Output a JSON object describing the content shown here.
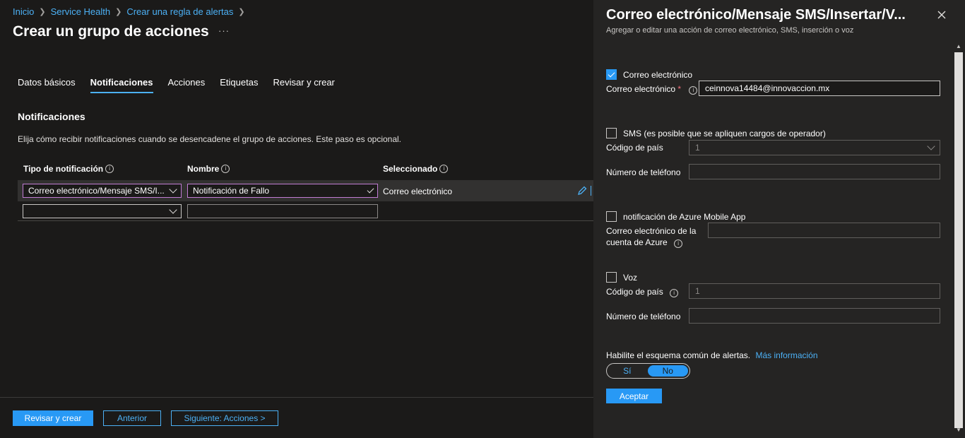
{
  "breadcrumb": [
    "Inicio",
    "Service Health",
    "Crear una regla de alertas"
  ],
  "page_title": "Crear un grupo de acciones",
  "more_label": "···",
  "tabs": [
    {
      "label": "Datos básicos"
    },
    {
      "label": "Notificaciones"
    },
    {
      "label": "Acciones"
    },
    {
      "label": "Etiquetas"
    },
    {
      "label": "Revisar y crear"
    }
  ],
  "section": {
    "title": "Notificaciones",
    "description": "Elija cómo recibir notificaciones cuando se desencadene el grupo de acciones. Este paso es opcional."
  },
  "table": {
    "headers": [
      "Tipo de notificación",
      "Nombre",
      "Seleccionado"
    ],
    "rows": [
      {
        "type": "Correo electrónico/Mensaje SMS/I...",
        "name": "Notificación de Fallo",
        "selected": "Correo electrónico"
      }
    ]
  },
  "footer": {
    "review": "Revisar y crear",
    "previous": "Anterior",
    "next": "Siguiente: Acciones >"
  },
  "panel": {
    "title": "Correo electrónico/Mensaje SMS/Insertar/V...",
    "subtitle": "Agregar o editar una acción de correo electrónico, SMS, inserción o voz",
    "email": {
      "checkbox_label": "Correo electrónico",
      "checked": true,
      "field_label": "Correo electrónico",
      "required_mark": "*",
      "value": "ceinnova14484@innovaccion.mx"
    },
    "sms": {
      "checkbox_label": "SMS (es posible que se apliquen cargos de operador)",
      "checked": false,
      "country_label": "Código de país",
      "country_value": "1",
      "phone_label": "Número de teléfono"
    },
    "app": {
      "checkbox_label": "notificación de Azure Mobile App",
      "checked": false,
      "field_label_1": "Correo electrónico de la",
      "field_label_2": "cuenta de Azure"
    },
    "voice": {
      "checkbox_label": "Voz",
      "checked": false,
      "country_label": "Código de país",
      "country_value": "1",
      "phone_label": "Número de teléfono"
    },
    "schema": {
      "label": "Habilite el esquema común de alertas.",
      "link": "Más información",
      "yes": "Sí",
      "no": "No",
      "selected": "No"
    },
    "accept": "Aceptar"
  },
  "colors": {
    "accent": "#2899f5",
    "link": "#4cb1f6",
    "focus_border": "#c17cd4",
    "background": "#1b1a19",
    "panel_background": "#252423"
  }
}
